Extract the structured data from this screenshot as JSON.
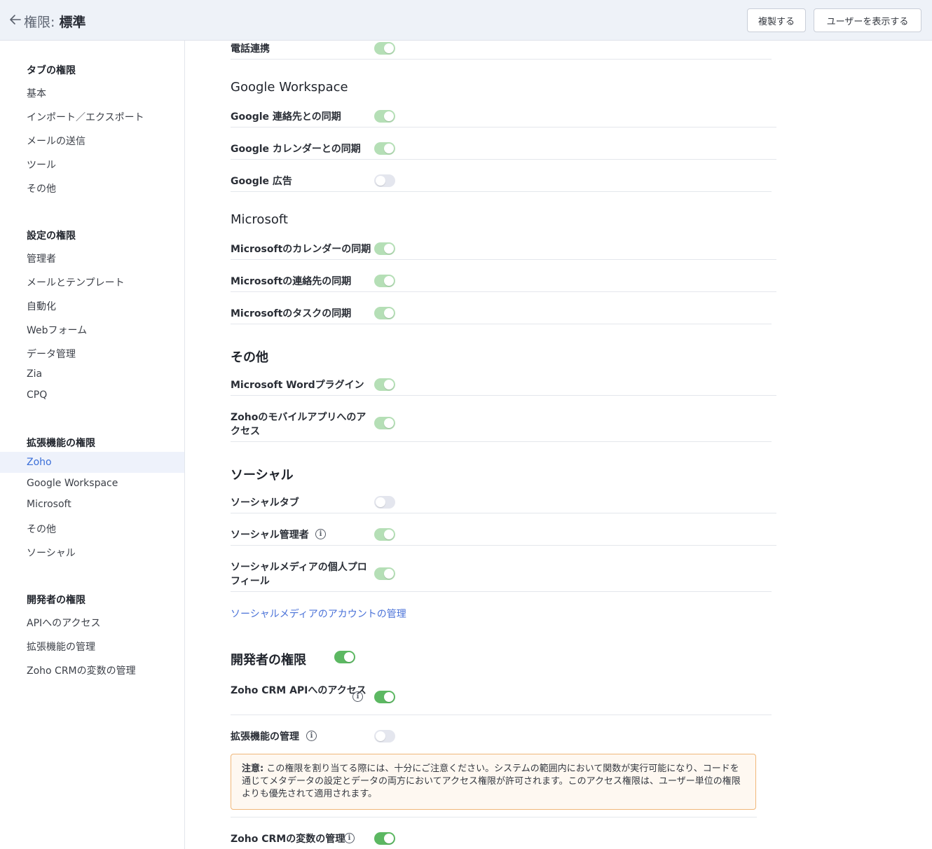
{
  "header": {
    "title_prefix": "権限:",
    "title_name": "標準",
    "clone_label": "複製する",
    "view_users_label": "ユーザーを表示する"
  },
  "sidebar": {
    "tab_head": "タブの権限",
    "tab_items": [
      "基本",
      "インポート／エクスポート",
      "メールの送信",
      "ツール",
      "その他"
    ],
    "setup_head": "設定の権限",
    "setup_items": [
      "管理者",
      "メールとテンプレート",
      "自動化",
      "Webフォーム",
      "データ管理",
      "Zia",
      "CPQ"
    ],
    "ext_head": "拡張機能の権限",
    "ext_items": [
      "Zoho",
      "Google Workspace",
      "Microsoft",
      "その他",
      "ソーシャル"
    ],
    "ext_active": "Zoho",
    "dev_head": "開発者の権限",
    "dev_items": [
      "APIへのアクセス",
      "拡張機能の管理",
      "Zoho CRMの変数の管理"
    ]
  },
  "main": {
    "phone": {
      "label": "電話連携",
      "state": "on"
    },
    "google": {
      "title": "Google Workspace",
      "items": [
        {
          "label": "Google 連絡先との同期",
          "state": "on"
        },
        {
          "label": "Google カレンダーとの同期",
          "state": "on"
        },
        {
          "label": "Google 広告",
          "state": "off"
        }
      ]
    },
    "microsoft": {
      "title": "Microsoft",
      "items": [
        {
          "label": "Microsoftのカレンダーの同期",
          "state": "on"
        },
        {
          "label": "Microsoftの連絡先の同期",
          "state": "on"
        },
        {
          "label": "Microsoftのタスクの同期",
          "state": "on"
        }
      ]
    },
    "other": {
      "title": "その他",
      "items": [
        {
          "label": "Microsoft Wordプラグイン",
          "state": "on"
        },
        {
          "label": "Zohoのモバイルアプリへのアクセス",
          "state": "on"
        }
      ]
    },
    "social": {
      "title": "ソーシャル",
      "items": [
        {
          "label": "ソーシャルタブ",
          "state": "off"
        },
        {
          "label": "ソーシャル管理者",
          "state": "on"
        },
        {
          "label": "ソーシャルメディアの個人プロフィール",
          "state": "on"
        }
      ],
      "link": "ソーシャルメディアのアカウントの管理"
    },
    "developer": {
      "title": "開発者の権限",
      "state": "on",
      "items": [
        {
          "label": "Zoho CRM APIへのアクセス",
          "state": "on"
        },
        {
          "label": "拡張機能の管理",
          "state": "off"
        },
        {
          "label": "Zoho CRMの変数の管理",
          "state": "on"
        }
      ],
      "note_label": "注意:",
      "note_text": "この権限を割り当てる際には、十分にご注意ください。システムの範囲内において関数が実行可能になり、コードを通じてメタデータの設定とデータの両方においてアクセス権限が許可されます。このアクセス権限は、ユーザー単位の権限よりも優先されて適用されます。"
    }
  },
  "colors": {
    "toggle_on_light": "#b5dfb6",
    "toggle_on_strong": "#5cb862",
    "toggle_off": "#e4e6ee",
    "link": "#4a72d8",
    "active": "#3b6fd8"
  }
}
